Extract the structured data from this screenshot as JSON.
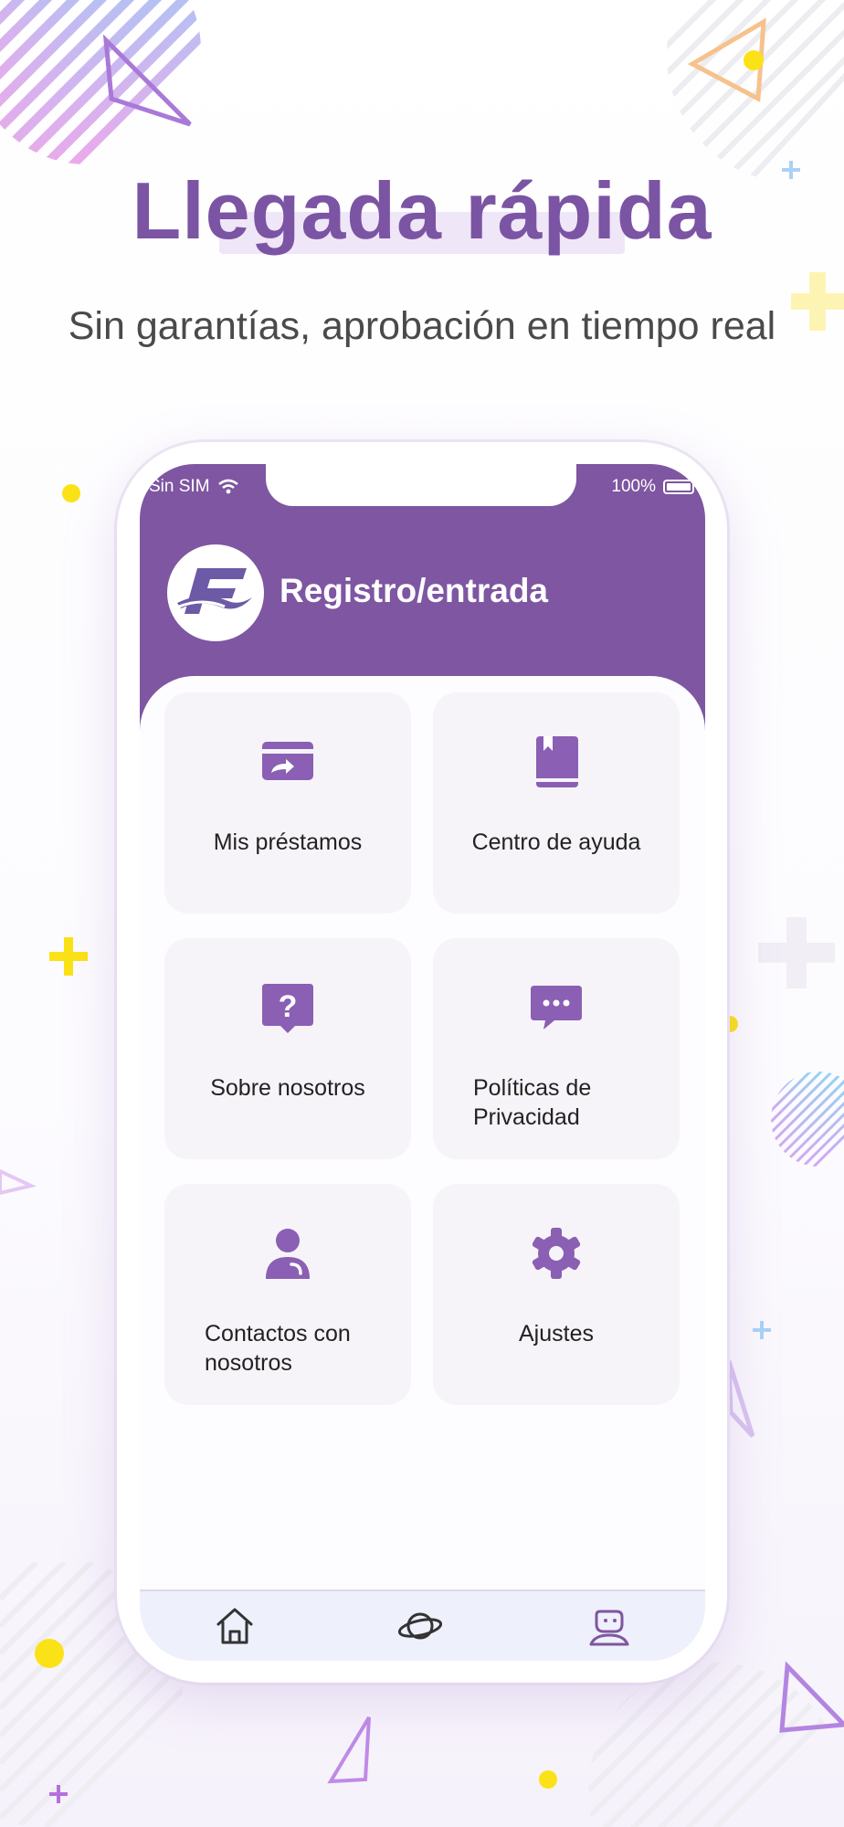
{
  "headline": "Llegada rápida",
  "subtitle": "Sin garantías, aprobación en tiempo real",
  "status_bar": {
    "carrier": "Sin SIM",
    "battery": "100%"
  },
  "header": {
    "title": "Registro/entrada"
  },
  "tiles": [
    {
      "label": "Mis préstamos",
      "icon": "card-transfer-icon"
    },
    {
      "label": "Centro de ayuda",
      "icon": "book-icon"
    },
    {
      "label": "Sobre nosotros",
      "icon": "question-bubble-icon"
    },
    {
      "label_line1": "Políticas de",
      "label_line2": "Privacidad",
      "icon": "chat-bubble-icon"
    },
    {
      "label_line1": "Contactos con",
      "label_line2": "nosotros",
      "icon": "person-icon"
    },
    {
      "label": "Ajustes",
      "icon": "gear-icon"
    }
  ],
  "tabbar": [
    {
      "icon": "home-icon"
    },
    {
      "icon": "planet-icon"
    },
    {
      "icon": "profile-icon"
    }
  ],
  "colors": {
    "brand_purple": "#7e56a1",
    "headline_purple": "#7b54a3",
    "accent_yellow": "#fbe216"
  }
}
